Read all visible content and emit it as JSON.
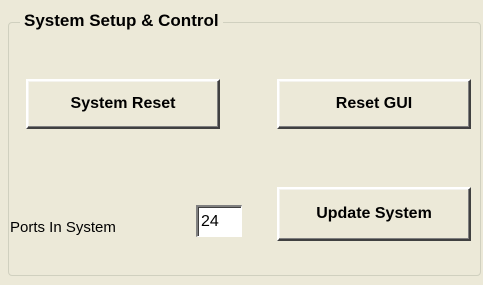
{
  "groupbox": {
    "title": "System Setup & Control"
  },
  "buttons": {
    "system_reset": "System Reset",
    "reset_gui": "Reset GUI",
    "update_system": "Update System"
  },
  "ports": {
    "label": "Ports In System",
    "value": "24"
  }
}
